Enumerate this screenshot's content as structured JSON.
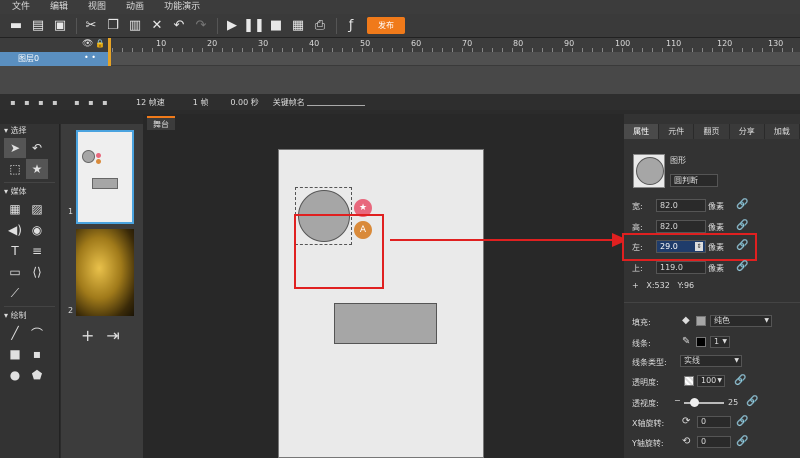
{
  "menu": [
    "文件",
    "编辑",
    "视图",
    "动画",
    "功能演示"
  ],
  "toolbar": {
    "publish_label": "发布"
  },
  "timeline": {
    "ruler": [
      "10",
      "20",
      "30",
      "40",
      "50",
      "60",
      "70",
      "80",
      "90",
      "100",
      "110",
      "120",
      "130"
    ],
    "layer_name": "图层0"
  },
  "status": {
    "fps": "12 帧速",
    "frame": "1 帧",
    "time": "0.00 秒",
    "keyframe_label": "关键帧名"
  },
  "tools": {
    "select_head": "选择",
    "media_head": "媒体",
    "draw_head": "绘制"
  },
  "pages": {
    "page1_num": "1",
    "page2_num": "2"
  },
  "stage": {
    "tab_label": "舞台"
  },
  "props": {
    "tabs": [
      "属性",
      "元件",
      "翻页",
      "分享",
      "加载"
    ],
    "type_label": "图形",
    "name_value": "圆判断",
    "width_label": "宽:",
    "width_value": "82.0",
    "height_label": "高:",
    "height_value": "82.0",
    "left_label": "左:",
    "left_value": "29.0",
    "top_label": "上:",
    "top_value": "119.0",
    "unit": "像素",
    "coord_x": "X:532",
    "coord_y": "Y:96",
    "fill_label": "填充:",
    "fill_value": "纯色",
    "stroke_label": "线条:",
    "stroke_width": "1",
    "stroke_type_label": "线条类型:",
    "stroke_type_value": "实线",
    "opacity_label": "透明度:",
    "opacity_value": "100",
    "blur_label": "透视度:",
    "blur_value": "25",
    "xrot_label": "X轴旋转:",
    "xrot_value": "0",
    "yrot_label": "Y轴旋转:",
    "yrot_value": "0"
  },
  "colors": {
    "publish": "#f07a1a",
    "selection": "#4aa3df",
    "highlight": "#e02020",
    "shape_fill": "#a6a6a6"
  }
}
